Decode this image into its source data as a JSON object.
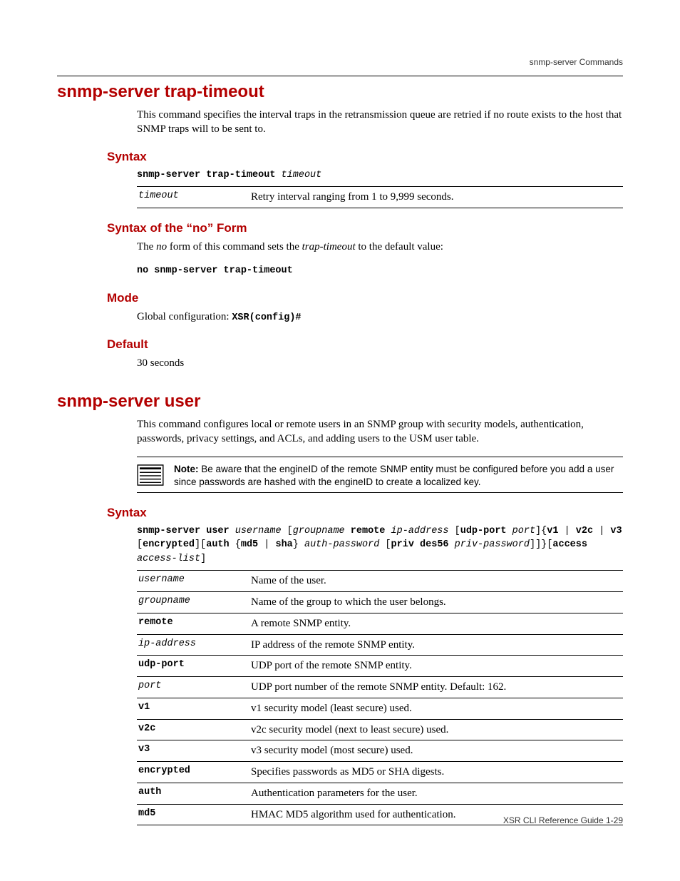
{
  "running_header": "snmp-server Commands",
  "footer": "XSR CLI Reference Guide    1-29",
  "section1": {
    "title": "snmp-server trap-timeout",
    "intro": "This command specifies the interval traps in the retransmission queue are retried if no route exists to the host that SNMP traps will to be sent to.",
    "syntax_heading": "Syntax",
    "syntax_cmd_bold": "snmp-server trap-timeout ",
    "syntax_cmd_arg": "timeout",
    "param_rows": [
      {
        "key": "timeout",
        "key_style": "italic",
        "desc": "Retry interval ranging from 1 to 9,999 seconds."
      }
    ],
    "noform_heading": "Syntax of the “no” Form",
    "noform_text_pre": "The ",
    "noform_text_em1": "no",
    "noform_text_mid": " form of this command sets the ",
    "noform_text_em2": "trap-timeout",
    "noform_text_post": " to the default value:",
    "noform_cmd": "no snmp-server trap-timeout",
    "mode_heading": "Mode",
    "mode_text": "Global configuration: ",
    "mode_code": "XSR(config)#",
    "default_heading": "Default",
    "default_text": "30 seconds"
  },
  "section2": {
    "title": "snmp-server user",
    "intro": "This command configures local or remote users in an SNMP group with security models, authentication, passwords, privacy settings, and ACLs, and adding users to the USM user table.",
    "note_label": "Note:",
    "note_text": " Be aware that the engineID of the remote SNMP entity must be configured before you add a user since passwords are hashed with the engineID to create a localized key.",
    "syntax_heading": "Syntax",
    "syntax_tokens": [
      {
        "t": "snmp-server user ",
        "s": "bold"
      },
      {
        "t": "username",
        "s": "italic"
      },
      {
        "t": " [",
        "s": ""
      },
      {
        "t": "groupname",
        "s": "italic"
      },
      {
        "t": " ",
        "s": ""
      },
      {
        "t": "remote",
        "s": "bold"
      },
      {
        "t": " ",
        "s": ""
      },
      {
        "t": "ip-address",
        "s": "italic"
      },
      {
        "t": " [",
        "s": ""
      },
      {
        "t": "udp-port",
        "s": "bold"
      },
      {
        "t": " ",
        "s": ""
      },
      {
        "t": "port",
        "s": "italic"
      },
      {
        "t": "]{",
        "s": ""
      },
      {
        "t": "v1",
        "s": "bold"
      },
      {
        "t": " | ",
        "s": ""
      },
      {
        "t": "v2c",
        "s": "bold"
      },
      {
        "t": " | ",
        "s": ""
      },
      {
        "t": "v3",
        "s": "bold"
      },
      {
        "t": " [",
        "s": ""
      },
      {
        "t": "encrypted",
        "s": "bold"
      },
      {
        "t": "][",
        "s": ""
      },
      {
        "t": "auth",
        "s": "bold"
      },
      {
        "t": " {",
        "s": ""
      },
      {
        "t": "md5",
        "s": "bold"
      },
      {
        "t": " | ",
        "s": ""
      },
      {
        "t": "sha",
        "s": "bold"
      },
      {
        "t": "} ",
        "s": ""
      },
      {
        "t": "auth-password",
        "s": "italic"
      },
      {
        "t": " [",
        "s": ""
      },
      {
        "t": "priv des56",
        "s": "bold"
      },
      {
        "t": " ",
        "s": ""
      },
      {
        "t": "priv-password",
        "s": "italic"
      },
      {
        "t": "]]}[",
        "s": ""
      },
      {
        "t": "access",
        "s": "bold"
      },
      {
        "t": " ",
        "s": ""
      },
      {
        "t": "access-list",
        "s": "italic"
      },
      {
        "t": "]",
        "s": ""
      }
    ],
    "param_rows": [
      {
        "key": "username",
        "key_style": "italic",
        "desc": "Name of the user."
      },
      {
        "key": "groupname",
        "key_style": "italic",
        "desc": "Name of the group to which the user belongs."
      },
      {
        "key": "remote",
        "key_style": "bold",
        "desc": "A remote SNMP entity."
      },
      {
        "key": "ip-address",
        "key_style": "italic",
        "desc": "IP address of the remote SNMP entity."
      },
      {
        "key": "udp-port",
        "key_style": "bold",
        "desc": "UDP port of the remote SNMP entity."
      },
      {
        "key": "port",
        "key_style": "italic",
        "desc": "UDP port number of the remote SNMP entity. Default: 162."
      },
      {
        "key": "v1",
        "key_style": "bold",
        "desc": "v1 security model (least secure) used."
      },
      {
        "key": "v2c",
        "key_style": "bold",
        "desc": "v2c security model (next to least secure) used."
      },
      {
        "key": "v3",
        "key_style": "bold",
        "desc": "v3 security model (most secure) used."
      },
      {
        "key": "encrypted",
        "key_style": "bold",
        "desc": "Specifies passwords as MD5 or SHA digests."
      },
      {
        "key": "auth",
        "key_style": "bold",
        "desc": "Authentication parameters for the user."
      },
      {
        "key": "md5",
        "key_style": "bold",
        "desc": "HMAC MD5 algorithm used for authentication."
      }
    ]
  }
}
